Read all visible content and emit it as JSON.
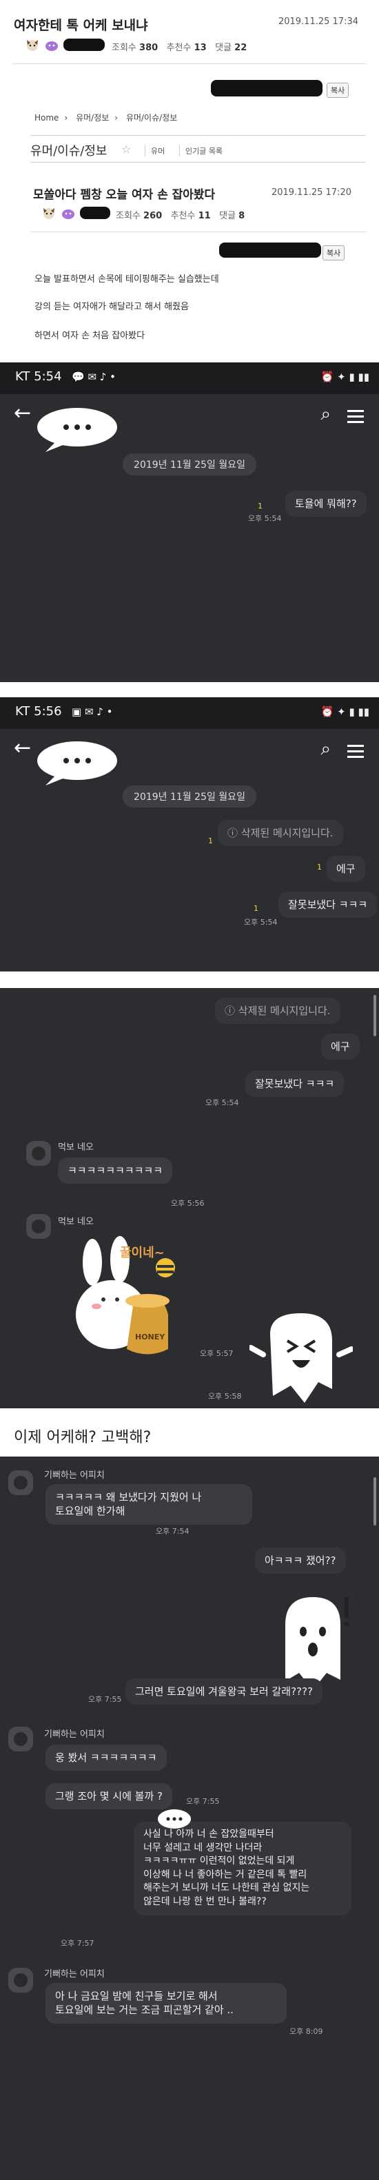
{
  "post": {
    "title": "여자한테 톡 어케 보내냐",
    "date": "2019.11.25 17:34",
    "views_label": "조회수",
    "views": "380",
    "recs_label": "추천수",
    "recs": "13",
    "comments_label": "댓글",
    "comments": "22",
    "copy_label": "복사",
    "breadcrumb": [
      "Home",
      "유머/정보",
      "유머/이슈/정보"
    ],
    "board": "유머/이슈/정보",
    "board_tabs": [
      "유머",
      "인기글 목록"
    ],
    "sub_title": "모쏠아다 펨창 오늘 여자 손 잡아봤다",
    "sub_date": "2019.11.25 17:20",
    "sub_views": "260",
    "sub_recs": "11",
    "sub_comments": "8",
    "body": [
      "오늘 발표하면서 손목에 테이핑해주는 실습했는데",
      "강의 듣는 여자애가 해달라고 해서 해줬음",
      "하면서 여자 손 처음 잡아봤다"
    ]
  },
  "chat1": {
    "carrier": "KT 5:54",
    "date": "2019년 11월 25일 월요일",
    "msg": "토욜에 뭐해??",
    "unread": "1",
    "time": "오후 5:54"
  },
  "chat2": {
    "carrier": "KT 5:56",
    "date": "2019년 11월 25일 월요일",
    "deleted": "삭제된 메시지입니다.",
    "msg2": "에구",
    "msg3": "잘못보냈다 ㅋㅋㅋ",
    "unread": "1",
    "time": "오후 5:54"
  },
  "chat3": {
    "deleted": "삭제된 메시지입니다.",
    "msg2": "에구",
    "msg3": "잘못보냈다 ㅋㅋㅋ",
    "time1": "오후 5:54",
    "user": "먹보 네오",
    "reply1": "ㅋㅋㅋㅋㅋㅋㅋㅋㅋㅋ",
    "time2": "오후 5:56",
    "sticker_text": "꿀이네~",
    "sticker_label": "HONEY",
    "time3": "오후 5:57",
    "time4": "오후 5:58"
  },
  "caption": "이제 어케해? 고백해?",
  "chat4": {
    "user": "기뻐하는 어피치",
    "r1a": "ㅋㅋㅋㅋㅋ 왜 보냈다가 지웠어 나",
    "r1b": "토요일에 한가해",
    "t1": "오후 7:54",
    "m1": "아ㅋㅋㅋ 쟀어??",
    "t2": "오후 7:55",
    "m2": "그러면 토요일에 겨울왕국 보러 갈래????",
    "r2": "웅 봤서 ㅋㅋㅋㅋㅋㅋㅋ",
    "r3": "그랭 조아 몇 시에 볼까 ?",
    "t3": "오후 7:55",
    "m3": [
      "사실 나 아까 너 손 잡았을때부터",
      "너무 설레고 네 생각만 나더라",
      "ㅋㅋㅋㅋㅠㅠ 이런적이 없었는데 되게",
      "이상해 나 너 좋아하는 거 같은데 톡 빨리",
      "해주는거 보니까 너도 나한테 관심 없지는",
      "않은데 나랑 한 번 만나 볼래??"
    ],
    "t4": "오후 7:57",
    "r4a": "아 나 금요일 밤에 친구들 보기로 해서",
    "r4b": "토요일에 보는 거는 조금 피곤할거 같아 ..",
    "t5": "오후 8:09"
  }
}
